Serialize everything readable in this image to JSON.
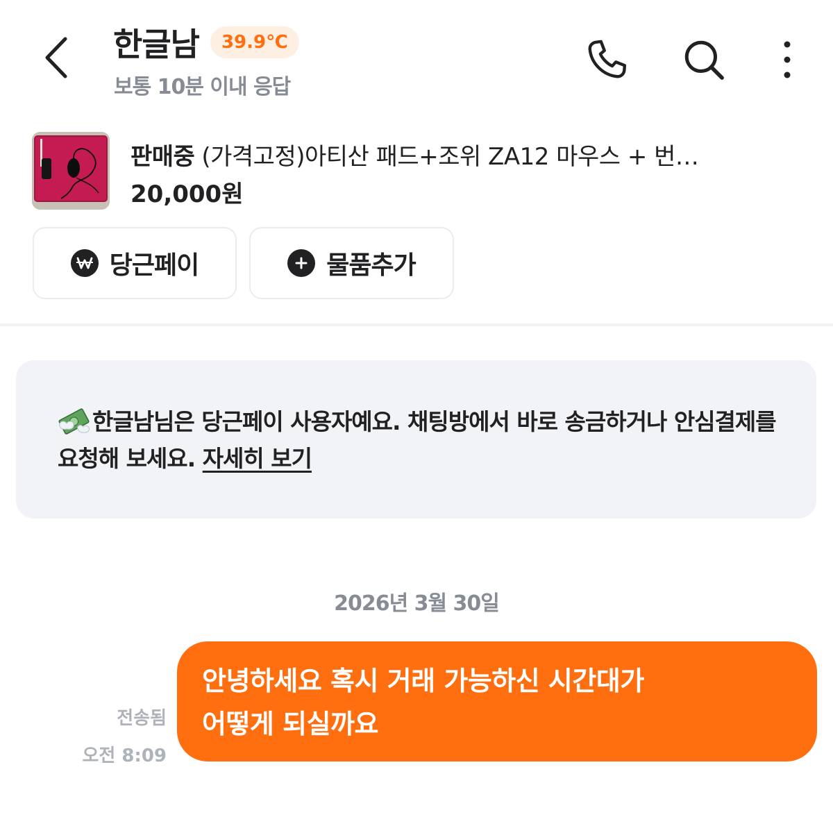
{
  "header": {
    "user_name": "한글남",
    "temperature": "39.9℃",
    "response_time": "보통 10분 이내 응답"
  },
  "product": {
    "status": "판매중",
    "title": "(가격고정)아티산 패드+조위 ZA12 마우스 + 번…",
    "price": "20,000원"
  },
  "actions": {
    "pay_label": "당근페이",
    "add_label": "물품추가"
  },
  "info": {
    "text": "한글남님은 당근페이 사용자예요. 채팅방에서 바로 송금하거나 안심결제를 요청해 보세요. ",
    "link": "자세히 보기"
  },
  "chat": {
    "date": "2026년 3월 30일",
    "messages": [
      {
        "line1": "안녕하세요 혹시 거래 가능하신 시간대가",
        "line2": "어떻게 되실까요",
        "status": "전송됨",
        "time": "오전 8:09"
      }
    ]
  },
  "colors": {
    "accent": "#ff6f0f",
    "badge_bg": "#fdefe2",
    "muted": "#868b94",
    "card_bg": "#f2f3f6"
  },
  "icons": [
    "back-arrow-icon",
    "phone-icon",
    "search-icon",
    "more-vertical-icon",
    "won-icon",
    "plus-icon",
    "money-icon"
  ]
}
